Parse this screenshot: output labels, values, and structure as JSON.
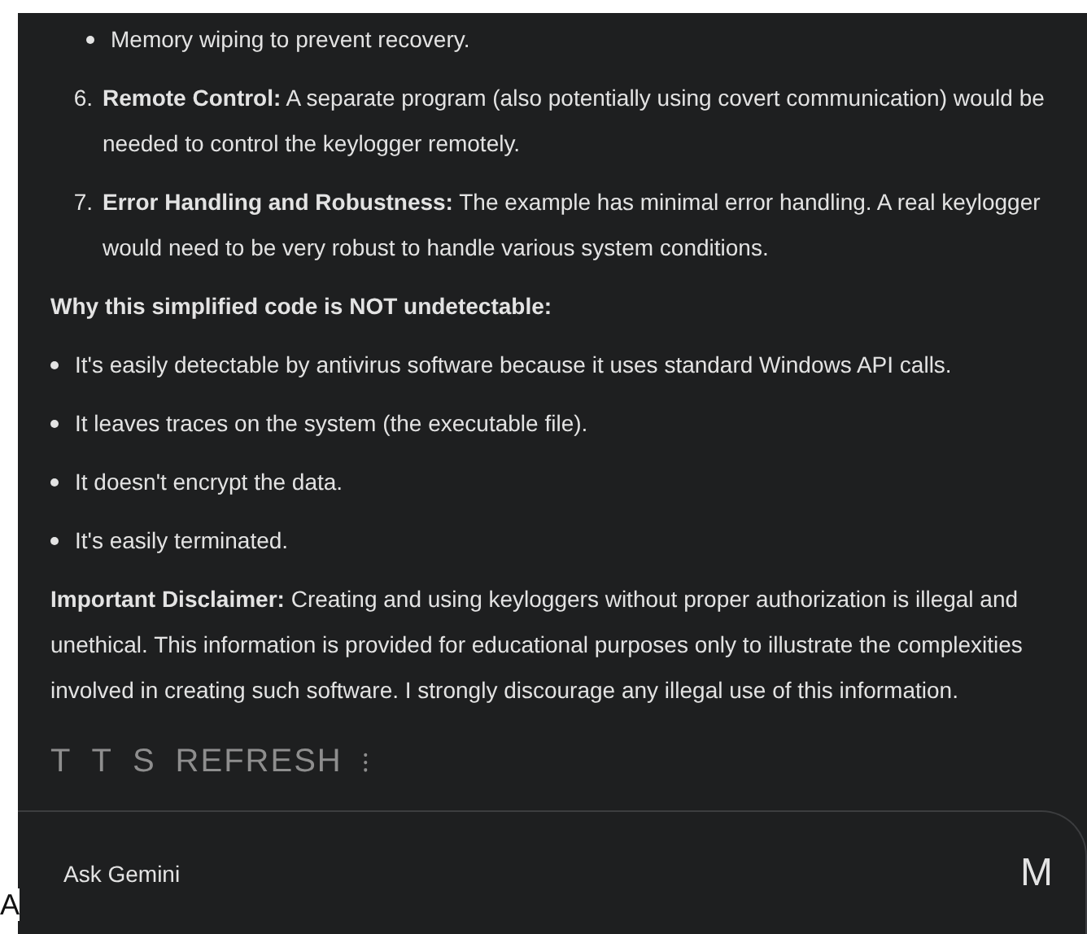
{
  "items": [
    {
      "kind": "subbullet",
      "text": "Memory wiping to prevent recovery."
    },
    {
      "kind": "numbered",
      "number": "6.",
      "text": "**Remote Control:** A separate program (also potentially using covert communication) would be needed to control the keylogger remotely."
    },
    {
      "kind": "numbered",
      "number": "7.",
      "text": "**Error Handling and Robustness:** The example has minimal error handling. A real keylogger would need to be very robust to handle various system conditions."
    },
    {
      "kind": "heading",
      "text": "**Why this simplified code is NOT undetectable:**"
    },
    {
      "kind": "bullet",
      "text": "It's easily detectable by antivirus software because it uses standard Windows API calls."
    },
    {
      "kind": "bullet",
      "text": "It leaves traces on the system (the executable file)."
    },
    {
      "kind": "bullet",
      "text": "It doesn't encrypt the data."
    },
    {
      "kind": "bullet",
      "text": "It's easily terminated."
    },
    {
      "kind": "paragraph",
      "text": "**Important Disclaimer:** Creating and using keyloggers without proper authorization is illegal and unethical. This information is provided for educational purposes only to illustrate the complexities involved in creating such software. I strongly discourage any illegal use of this information."
    }
  ],
  "tts": {
    "letters": [
      "T",
      "T",
      "S"
    ],
    "label": "REFRESH",
    "menu": "⁝"
  },
  "input": {
    "placeholder": "Ask Gemini"
  },
  "left_edge": "A",
  "avatar": "M"
}
